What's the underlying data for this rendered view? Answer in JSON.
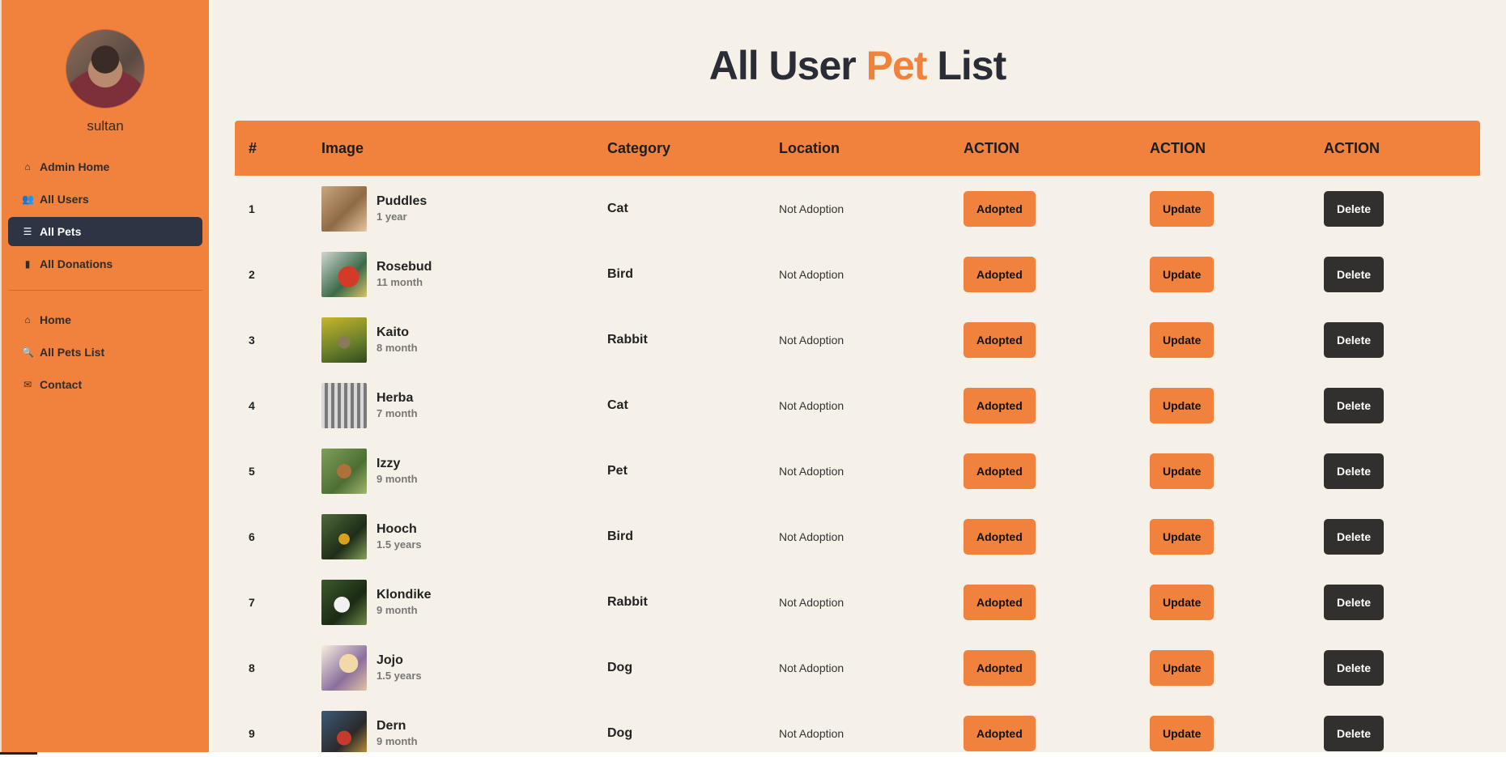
{
  "sidebar": {
    "username": "sultan",
    "admin_nav": [
      {
        "label": "Admin Home",
        "icon": "home-icon",
        "glyph": "⌂"
      },
      {
        "label": "All Users",
        "icon": "users-icon",
        "glyph": "👥"
      },
      {
        "label": "All Pets",
        "icon": "list-icon",
        "glyph": "☰",
        "active": true
      },
      {
        "label": "All Donations",
        "icon": "book-icon",
        "glyph": "▮"
      }
    ],
    "site_nav": [
      {
        "label": "Home",
        "icon": "home-icon",
        "glyph": "⌂"
      },
      {
        "label": "All Pets List",
        "icon": "search-icon",
        "glyph": "🔍"
      },
      {
        "label": "Contact",
        "icon": "envelope-icon",
        "glyph": "✉"
      }
    ]
  },
  "title": {
    "part1": "All User ",
    "accent": "Pet",
    "part2": " List"
  },
  "colors": {
    "accent": "#f0823d",
    "dark": "#2e3444",
    "background": "#f6f1e8"
  },
  "table": {
    "headers": [
      "#",
      "Image",
      "Category",
      "Location",
      "ACTION",
      "ACTION",
      "ACTION"
    ],
    "rows": [
      {
        "num": "1",
        "name": "Puddles",
        "age": "1 year",
        "category": "Cat",
        "location": "Not Adoption",
        "adopt": "Adopted",
        "update": "Update",
        "delete": "Delete"
      },
      {
        "num": "2",
        "name": "Rosebud",
        "age": "11 month",
        "category": "Bird",
        "location": "Not Adoption",
        "adopt": "Adopted",
        "update": "Update",
        "delete": "Delete"
      },
      {
        "num": "3",
        "name": "Kaito",
        "age": "8 month",
        "category": "Rabbit",
        "location": "Not Adoption",
        "adopt": "Adopted",
        "update": "Update",
        "delete": "Delete"
      },
      {
        "num": "4",
        "name": "Herba",
        "age": "7 month",
        "category": "Cat",
        "location": "Not Adoption",
        "adopt": "Adopted",
        "update": "Update",
        "delete": "Delete"
      },
      {
        "num": "5",
        "name": "Izzy",
        "age": "9 month",
        "category": "Pet",
        "location": "Not Adoption",
        "adopt": "Adopted",
        "update": "Update",
        "delete": "Delete"
      },
      {
        "num": "6",
        "name": "Hooch",
        "age": "1.5 years",
        "category": "Bird",
        "location": "Not Adoption",
        "adopt": "Adopted",
        "update": "Update",
        "delete": "Delete"
      },
      {
        "num": "7",
        "name": "Klondike",
        "age": "9 month",
        "category": "Rabbit",
        "location": "Not Adoption",
        "adopt": "Adopted",
        "update": "Update",
        "delete": "Delete"
      },
      {
        "num": "8",
        "name": "Jojo",
        "age": "1.5 years",
        "category": "Dog",
        "location": "Not Adoption",
        "adopt": "Adopted",
        "update": "Update",
        "delete": "Delete"
      },
      {
        "num": "9",
        "name": "Dern",
        "age": "9 month",
        "category": "Dog",
        "location": "Not Adoption",
        "adopt": "Adopted",
        "update": "Update",
        "delete": "Delete"
      }
    ]
  }
}
